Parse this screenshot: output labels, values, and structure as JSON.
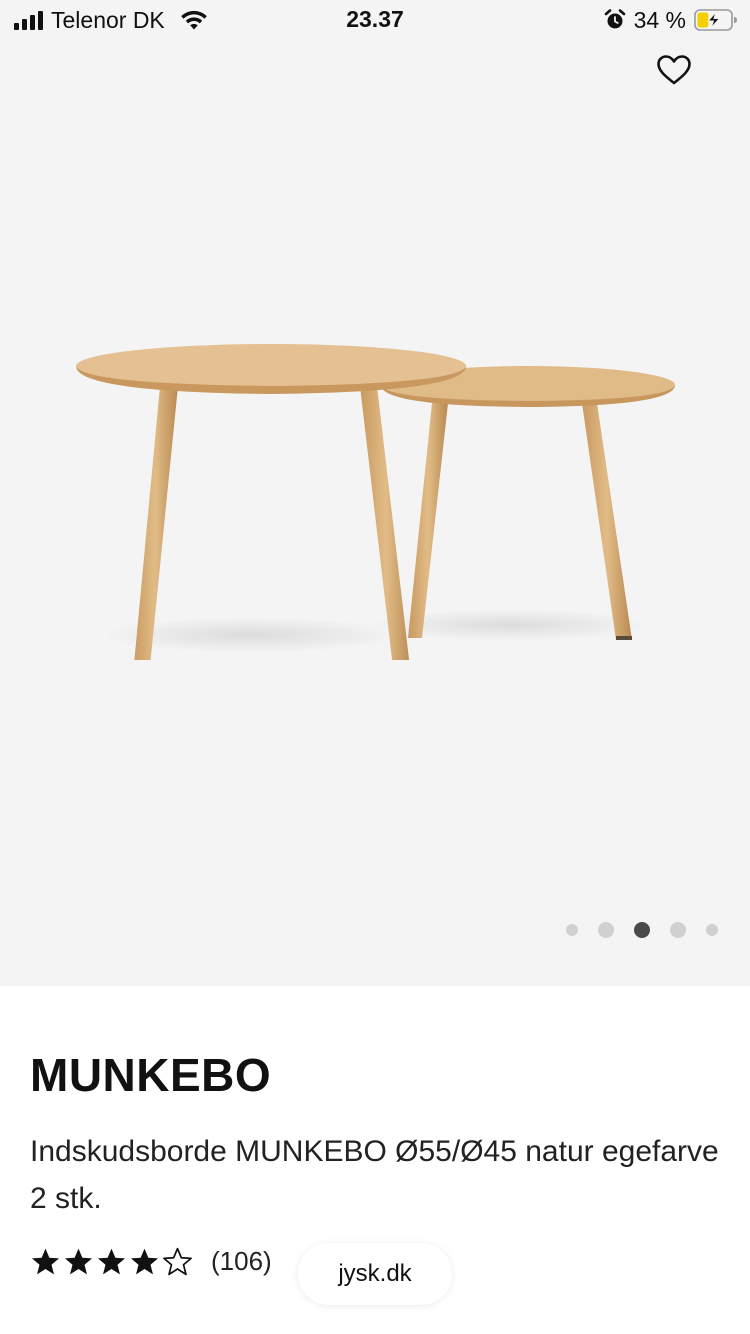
{
  "status_bar": {
    "carrier": "Telenor DK",
    "time": "23.37",
    "battery": "34 %",
    "battery_level": 0.34,
    "signal_icon": "cellular-signal-icon",
    "wifi_icon": "wifi-icon",
    "alarm_icon": "alarm-clock-icon",
    "battery_icon": "battery-charging-icon"
  },
  "gallery": {
    "favorite_icon": "heart-outline-icon",
    "image_count": 5,
    "active_image_index": 2
  },
  "product": {
    "name": "MUNKEBO",
    "description": "Indskudsborde MUNKEBO Ø55/Ø45 natur egefarve 2 stk.",
    "rating": 4,
    "max_rating": 5,
    "review_count": "(106)"
  },
  "browser": {
    "url": "jysk.dk"
  },
  "colors": {
    "background": "#f4f4f4",
    "wood": "#d9b27e",
    "text": "#111111",
    "battery_charge": "#f5d000"
  }
}
